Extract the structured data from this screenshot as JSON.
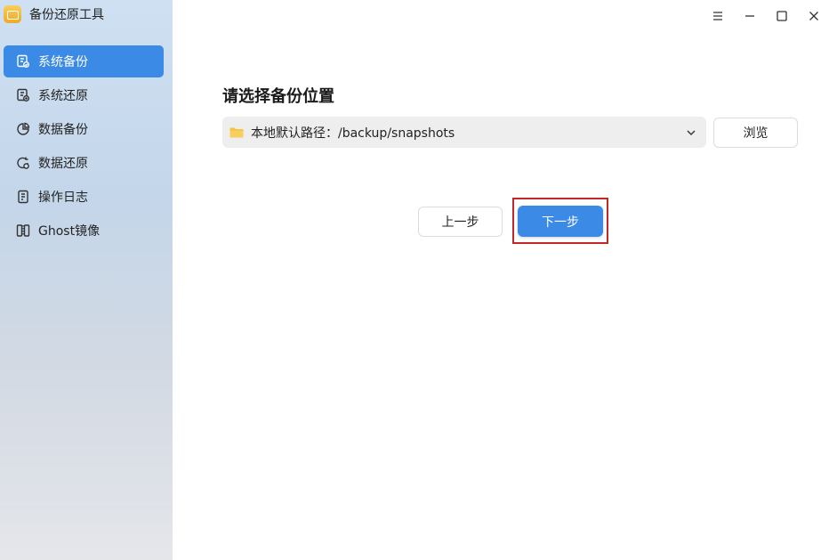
{
  "app": {
    "title": "备份还原工具",
    "logo_icon": "folder-app-icon"
  },
  "window_controls": {
    "menu_icon": "hamburger-menu-icon",
    "minimize_icon": "minimize-icon",
    "maximize_icon": "maximize-icon",
    "close_icon": "close-icon"
  },
  "sidebar": {
    "items": [
      {
        "label": "系统备份",
        "icon": "system-backup-icon",
        "active": true
      },
      {
        "label": "系统还原",
        "icon": "system-restore-icon",
        "active": false
      },
      {
        "label": "数据备份",
        "icon": "data-backup-icon",
        "active": false
      },
      {
        "label": "数据还原",
        "icon": "data-restore-icon",
        "active": false
      },
      {
        "label": "操作日志",
        "icon": "log-icon",
        "active": false
      },
      {
        "label": "Ghost镜像",
        "icon": "ghost-image-icon",
        "active": false
      }
    ]
  },
  "main": {
    "title": "请选择备份位置",
    "path_select": {
      "value": "本地默认路径：/backup/snapshots",
      "icon": "folder-icon"
    },
    "browse_label": "浏览",
    "prev_label": "上一步",
    "next_label": "下一步"
  },
  "colors": {
    "accent": "#3b8ae6",
    "highlight": "#c62828",
    "folder": "#f5c242"
  }
}
